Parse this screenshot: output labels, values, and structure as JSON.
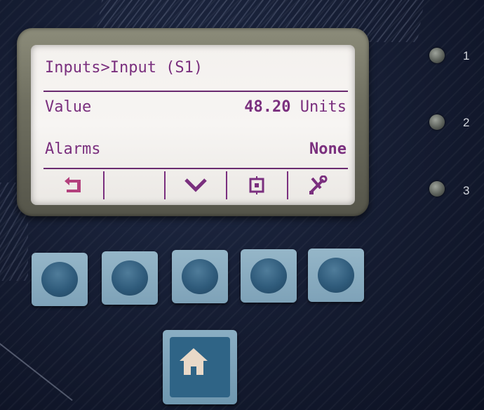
{
  "lcd": {
    "breadcrumb": "Inputs>Input (S1)",
    "value_label": "Value",
    "value_number": "48.20",
    "value_unit": "Units",
    "alarms_label": "Alarms",
    "alarms_value": "None"
  },
  "softkeys": [
    {
      "icon": "back-arrow-icon"
    },
    {
      "icon": ""
    },
    {
      "icon": "chevron-down-icon"
    },
    {
      "icon": "select-icon"
    },
    {
      "icon": "tools-icon"
    }
  ],
  "leds": [
    {
      "label": "1",
      "state": "off"
    },
    {
      "label": "2",
      "state": "off"
    },
    {
      "label": "3",
      "state": "off"
    }
  ],
  "colors": {
    "lcd_text": "#7a2f7e",
    "lcd_background": "#f4f1ee",
    "panel": "#141b30",
    "button": "#7ea2b8"
  }
}
